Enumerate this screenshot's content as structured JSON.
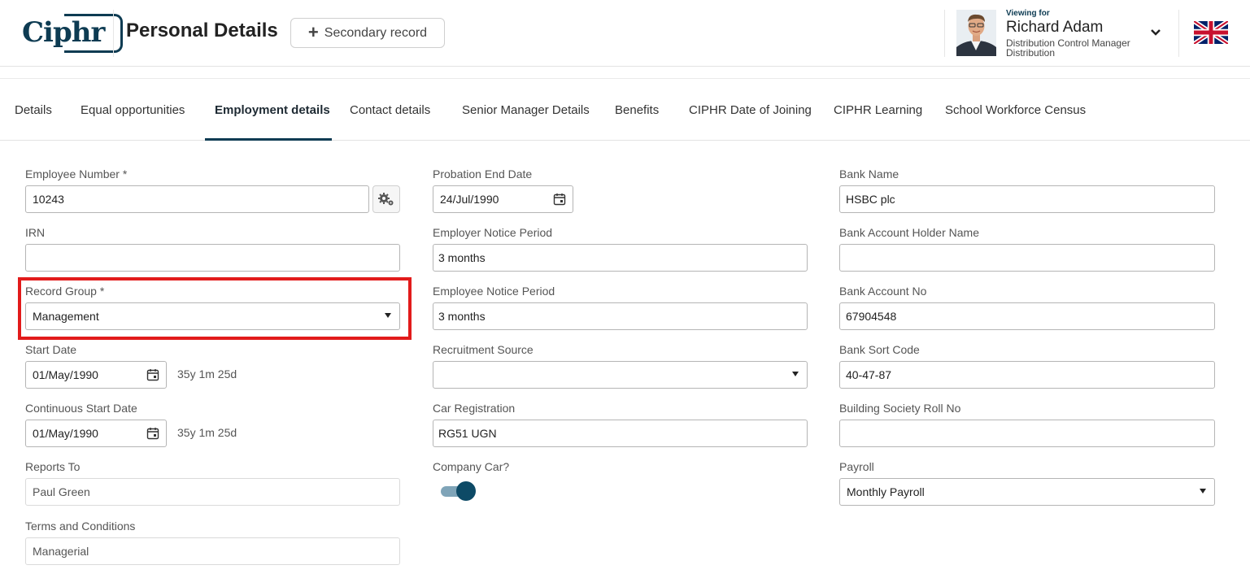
{
  "header": {
    "logo_text": "Ciphr",
    "page_title": "Personal Details",
    "secondary_record_label": "Secondary record",
    "viewing_for_label": "Viewing for",
    "user_name": "Richard Adam",
    "user_role": "Distribution Control Manager",
    "user_department": "Distribution",
    "flag_icon": "uk-flag-icon"
  },
  "tabs": [
    {
      "label": "Details",
      "active": false
    },
    {
      "label": "Equal opportunities",
      "active": false
    },
    {
      "label": "Employment details",
      "active": true
    },
    {
      "label": "Contact details",
      "active": false
    },
    {
      "label": "Senior Manager Details",
      "active": false
    },
    {
      "label": "Benefits",
      "active": false
    },
    {
      "label": "CIPHR Date of Joining",
      "active": false
    },
    {
      "label": "CIPHR Learning",
      "active": false
    },
    {
      "label": "School Workforce Census",
      "active": false
    }
  ],
  "col1": {
    "employee_number": {
      "label": "Employee Number *",
      "value": "10243"
    },
    "irn": {
      "label": "IRN",
      "value": ""
    },
    "record_group": {
      "label": "Record Group *",
      "value": "Management"
    },
    "start_date": {
      "label": "Start Date",
      "value": "01/May/1990",
      "duration": "35y 1m 25d"
    },
    "continuous_start_date": {
      "label": "Continuous Start Date",
      "value": "01/May/1990",
      "duration": "35y 1m 25d"
    },
    "reports_to": {
      "label": "Reports To",
      "value": "Paul Green"
    },
    "terms_and_conditions": {
      "label": "Terms and Conditions",
      "value": "Managerial"
    }
  },
  "col2": {
    "probation_end_date": {
      "label": "Probation End Date",
      "value": "24/Jul/1990"
    },
    "employer_notice_period": {
      "label": "Employer Notice Period",
      "value": "3 months"
    },
    "employee_notice_period": {
      "label": "Employee Notice Period",
      "value": "3 months"
    },
    "recruitment_source": {
      "label": "Recruitment Source",
      "value": ""
    },
    "car_registration": {
      "label": "Car Registration",
      "value": "RG51 UGN"
    },
    "company_car": {
      "label": "Company Car?",
      "value": true
    }
  },
  "col3": {
    "bank_name": {
      "label": "Bank Name",
      "value": "HSBC plc"
    },
    "bank_account_holder_name": {
      "label": "Bank Account Holder Name",
      "value": ""
    },
    "bank_account_no": {
      "label": "Bank Account No",
      "value": "67904548"
    },
    "bank_sort_code": {
      "label": "Bank Sort Code",
      "value": "40-47-87"
    },
    "building_society_roll_no": {
      "label": "Building Society Roll No",
      "value": ""
    },
    "payroll": {
      "label": "Payroll",
      "value": "Monthly Payroll"
    }
  },
  "colors": {
    "brand": "#0d3b52",
    "highlight": "#e21b1b"
  }
}
